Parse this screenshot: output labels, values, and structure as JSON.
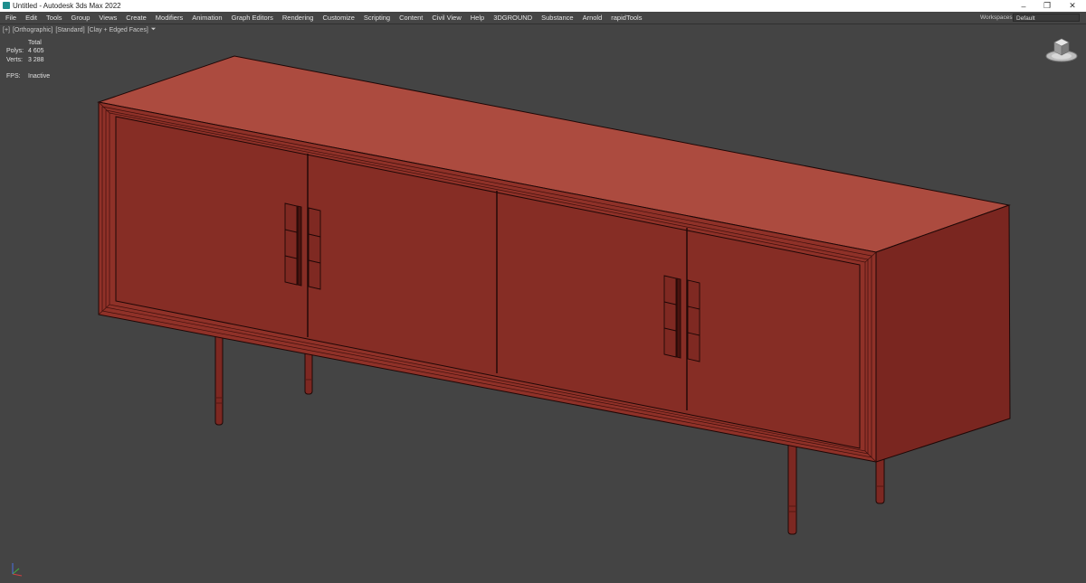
{
  "window": {
    "title": "Untitled - Autodesk 3ds Max 2022"
  },
  "menubar": {
    "items": [
      "File",
      "Edit",
      "Tools",
      "Group",
      "Views",
      "Create",
      "Modifiers",
      "Animation",
      "Graph Editors",
      "Rendering",
      "Customize",
      "Scripting",
      "Content",
      "Civil View",
      "Help",
      "3DGROUND",
      "Substance",
      "Arnold",
      "rapidTools"
    ],
    "workspaces_label": "Workspaces:",
    "workspace_value": "Default"
  },
  "viewport": {
    "labels": [
      "[+]",
      "[Orthographic]",
      "[Standard]",
      "[Clay + Edged Faces]"
    ],
    "filter_icon": "funnel-icon",
    "stats": {
      "header": "Total",
      "polys_label": "Polys:",
      "polys_value": "4 605",
      "verts_label": "Verts:",
      "verts_value": "3 288",
      "fps_label": "FPS:",
      "fps_value": "Inactive"
    },
    "background_color": "#444444",
    "model_color": "#8c2f27",
    "gizmo_axes": [
      "x-axis",
      "y-axis",
      "z-axis"
    ],
    "viewcube_icon": "viewcube-icon"
  }
}
